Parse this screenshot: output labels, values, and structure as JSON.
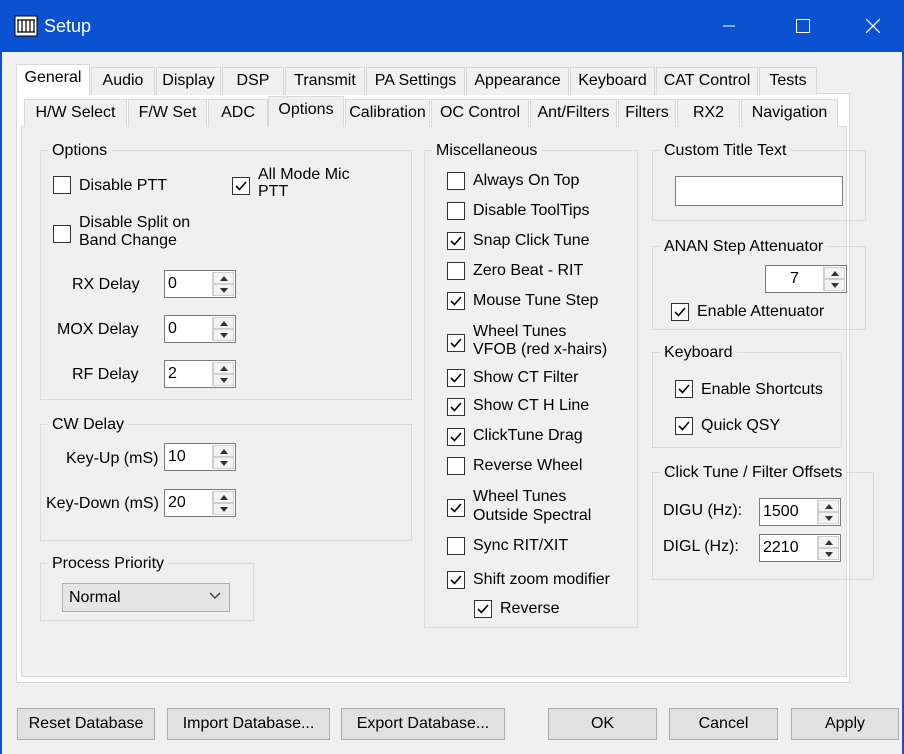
{
  "window": {
    "title": "Setup",
    "app_icon": "setup-app-icon",
    "controls": [
      "minimize-icon",
      "maximize-icon",
      "close-icon"
    ]
  },
  "main_tabs": [
    {
      "label": "General",
      "selected": true
    },
    {
      "label": "Audio",
      "selected": false
    },
    {
      "label": "Display",
      "selected": false
    },
    {
      "label": "DSP",
      "selected": false
    },
    {
      "label": "Transmit",
      "selected": false
    },
    {
      "label": "PA Settings",
      "selected": false
    },
    {
      "label": "Appearance",
      "selected": false
    },
    {
      "label": "Keyboard",
      "selected": false
    },
    {
      "label": "CAT Control",
      "selected": false
    },
    {
      "label": "Tests",
      "selected": false
    }
  ],
  "sub_tabs": [
    {
      "label": "H/W Select",
      "selected": false
    },
    {
      "label": "F/W Set",
      "selected": false
    },
    {
      "label": "ADC",
      "selected": false
    },
    {
      "label": "Options",
      "selected": true
    },
    {
      "label": "Calibration",
      "selected": false
    },
    {
      "label": "OC Control",
      "selected": false
    },
    {
      "label": "Ant/Filters",
      "selected": false
    },
    {
      "label": "Filters",
      "selected": false
    },
    {
      "label": "RX2",
      "selected": false
    },
    {
      "label": "Navigation",
      "selected": false
    }
  ],
  "options_group": {
    "title": "Options",
    "disable_ptt": {
      "label": "Disable PTT",
      "checked": false
    },
    "all_mode_mic_ptt": {
      "line1": "All Mode Mic",
      "line2": "PTT",
      "checked": true
    },
    "disable_split": {
      "line1": "Disable Split on",
      "line2": "Band Change",
      "checked": false
    },
    "rx_delay": {
      "label": "RX Delay",
      "value": "0"
    },
    "mox_delay": {
      "label": "MOX Delay",
      "value": "0"
    },
    "rf_delay": {
      "label": "RF Delay",
      "value": "2"
    }
  },
  "cw_delay_group": {
    "title": "CW Delay",
    "key_up": {
      "label": "Key-Up (mS)",
      "value": "10"
    },
    "key_down": {
      "label": "Key-Down (mS)",
      "value": "20"
    }
  },
  "process_priority_group": {
    "title": "Process Priority",
    "selected": "Normal"
  },
  "misc_group": {
    "title": "Miscellaneous",
    "items": {
      "always_on_top": {
        "label": "Always On Top",
        "checked": false
      },
      "disable_tooltips": {
        "label": "Disable ToolTips",
        "checked": false
      },
      "snap_click_tune": {
        "label": "Snap Click Tune",
        "checked": true
      },
      "zero_beat_rit": {
        "label": "Zero Beat -  RIT",
        "checked": false
      },
      "mouse_tune_step": {
        "label": "Mouse Tune Step",
        "checked": true
      },
      "wheel_tunes_vfob": {
        "line1": "Wheel Tunes",
        "line2": "VFOB (red x-hairs)",
        "checked": true
      },
      "show_ct_filter": {
        "label": "Show CT Filter",
        "checked": true
      },
      "show_ct_h_line": {
        "label": "Show CT H Line",
        "checked": true
      },
      "clicktune_drag": {
        "label": "ClickTune Drag",
        "checked": true
      },
      "reverse_wheel": {
        "label": "Reverse Wheel",
        "checked": false
      },
      "wheel_tunes_outside": {
        "line1": "Wheel Tunes",
        "line2": "Outside Spectral",
        "checked": true
      },
      "sync_rit_xit": {
        "label": "Sync RIT/XIT",
        "checked": false
      },
      "shift_zoom_modifier": {
        "label": "Shift zoom modifier",
        "checked": true
      },
      "reverse": {
        "label": "Reverse",
        "checked": true
      }
    }
  },
  "custom_title_group": {
    "title": "Custom Title Text",
    "value": ""
  },
  "anan_group": {
    "title": "ANAN Step Attenuator",
    "value": "7",
    "enable": {
      "label": "Enable Attenuator",
      "checked": true
    }
  },
  "keyboard_group": {
    "title": "Keyboard",
    "enable_shortcuts": {
      "label": "Enable Shortcuts",
      "checked": true
    },
    "quick_qsy": {
      "label": "Quick QSY",
      "checked": true
    }
  },
  "click_tune_group": {
    "title": "Click Tune / Filter Offsets",
    "digu": {
      "label": "DIGU (Hz):",
      "value": "1500"
    },
    "digl": {
      "label": "DIGL (Hz):",
      "value": "2210"
    }
  },
  "buttons": {
    "reset": "Reset Database",
    "import": "Import Database...",
    "export": "Export Database...",
    "ok": "OK",
    "cancel": "Cancel",
    "apply": "Apply"
  },
  "colors": {
    "titlebar": "#0b52d2",
    "panel": "#f0f0f0",
    "tab_selected": "#ffffff"
  }
}
